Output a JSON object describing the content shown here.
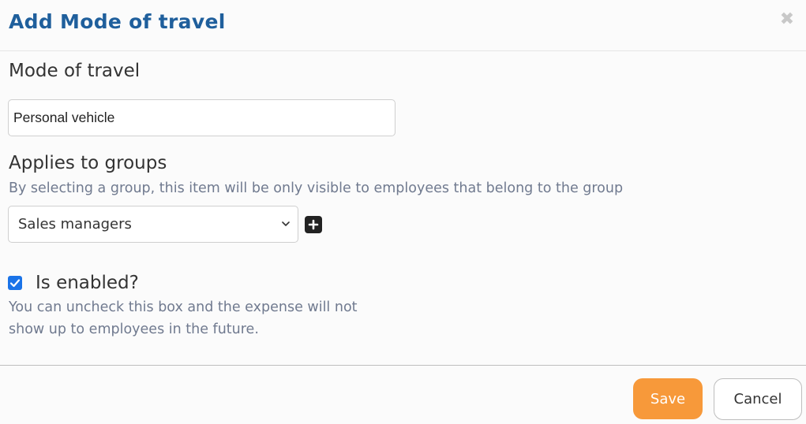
{
  "modal": {
    "title": "Add Mode of travel",
    "close_glyph": "✖"
  },
  "mode_field": {
    "label": "Mode of travel",
    "value": "Personal vehicle"
  },
  "groups_field": {
    "label": "Applies to groups",
    "help": "By selecting a group, this item will be only visible to employees that belong to the group",
    "selected": "Sales managers",
    "add_icon": "plus-square-icon"
  },
  "enabled_field": {
    "label": "Is enabled?",
    "checked": true,
    "help_line1": "You can uncheck this box and the expense will not",
    "help_line2": "show up to employees in the future."
  },
  "footer": {
    "save_label": "Save",
    "cancel_label": "Cancel"
  },
  "colors": {
    "title": "#1f5f9c",
    "save_button": "#f7993a",
    "checkbox": "#1a73e8",
    "help_text": "#707a8f"
  }
}
